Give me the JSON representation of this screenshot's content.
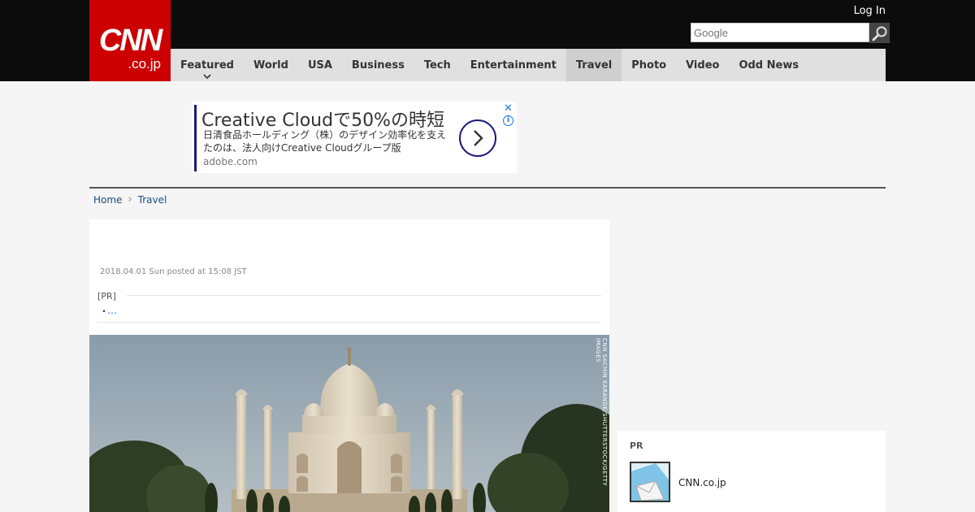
{
  "header": {
    "logo_main": "CNN",
    "logo_sub": ".co.jp",
    "login": "Log In",
    "search_placeholder": "Google"
  },
  "nav": {
    "items": [
      {
        "label": "Featured",
        "active": false,
        "has_dropdown": true
      },
      {
        "label": "World",
        "active": false
      },
      {
        "label": "USA",
        "active": false
      },
      {
        "label": "Business",
        "active": false
      },
      {
        "label": "Tech",
        "active": false
      },
      {
        "label": "Entertainment",
        "active": false
      },
      {
        "label": "Travel",
        "active": true
      },
      {
        "label": "Photo",
        "active": false
      },
      {
        "label": "Video",
        "active": false
      },
      {
        "label": "Odd News",
        "active": false
      }
    ]
  },
  "ad": {
    "title": "Creative Cloudで50%の時短",
    "description": "日清食品ホールディング（株）のデザイン効率化を支えたのは、法人向けCreative Cloudグループ版",
    "url": "adobe.com",
    "close": "✕",
    "info": "i"
  },
  "breadcrumb": {
    "home": "Home",
    "current": "Travel"
  },
  "article": {
    "date": "2018.04.01 Sun posted at 15:08 JST",
    "pr_label": "[PR]",
    "pr_bullet": "・",
    "pr_link": "…",
    "photo_credit": "CNN SACHIN KARANDE/SHUTTERSTOCK/GETTY IMAGES"
  },
  "sidebar": {
    "pr_label": "PR",
    "item_name": "CNN.co.jp"
  },
  "colors": {
    "brand_red": "#cc0000",
    "topbar": "#0c0c0c",
    "nav_bg": "#e0e0e0",
    "link": "#1a4d80"
  }
}
